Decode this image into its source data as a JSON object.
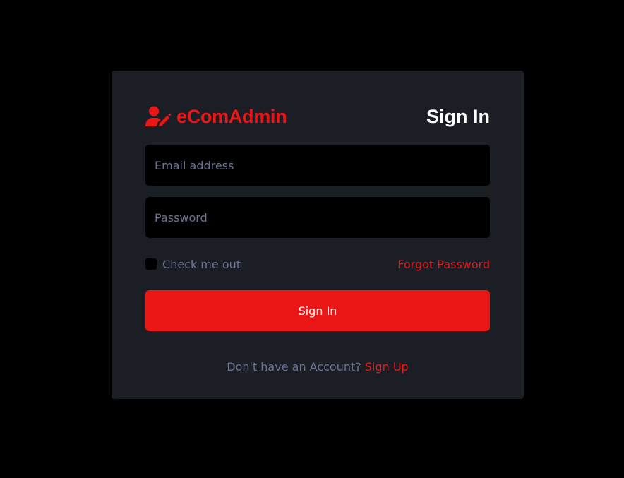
{
  "brand": {
    "name": "eComAdmin",
    "icon": "user-edit-icon"
  },
  "header": {
    "title": "Sign In"
  },
  "form": {
    "email_placeholder": "Email address",
    "password_placeholder": "Password",
    "remember_label": "Check me out",
    "forgot_label": "Forgot Password",
    "submit_label": "Sign In"
  },
  "footer": {
    "prompt": "Don't have an Account?",
    "signup_label": "Sign Up"
  },
  "colors": {
    "accent": "#eb1616",
    "card": "#1c1e26",
    "background": "#000000",
    "muted_text": "#6c7293"
  }
}
